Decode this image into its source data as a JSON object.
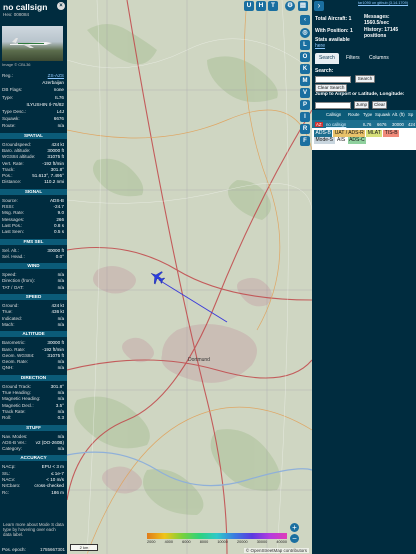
{
  "left": {
    "title": "no callsign",
    "hex_label": "Hex: 008084",
    "photo_credit": "Image © CBL36",
    "info": [
      {
        "k": "Reg.:",
        "v": "ZS-AZS",
        "link": true
      },
      {
        "k": "",
        "v": "Azerbaijan",
        "link": false
      },
      {
        "k": "DB Flags:",
        "v": "none",
        "link": false
      },
      {
        "k": "Type:",
        "v": "IL76",
        "link": false
      },
      {
        "k": "",
        "v": "ILYUSHIN Il-76/82",
        "link": false
      },
      {
        "k": "Type Desc.:",
        "v": "L4J",
        "link": false
      },
      {
        "k": "Squawk:",
        "v": "6676",
        "link": false
      },
      {
        "k": "Route:",
        "v": "n/a",
        "link": false
      }
    ],
    "sections": {
      "spatial": {
        "title": "SPATIAL",
        "rows": [
          {
            "k": "Groundspeed:",
            "v": "424 kt"
          },
          {
            "k": "Baro. altitude:",
            "v": "30000 ft"
          },
          {
            "k": "WGS84 altitude:",
            "v": "31075 ft"
          },
          {
            "k": "Vert. Rate:",
            "v": "-192 ft/min"
          },
          {
            "k": "Track:",
            "v": "301.8°"
          },
          {
            "k": "Pos.:",
            "v": "51.613°, 7.495°"
          },
          {
            "k": "Distance:",
            "v": "110.2 nmi"
          }
        ]
      },
      "signal": {
        "title": "SIGNAL",
        "rows": [
          {
            "k": "Source:",
            "v": "ADS-B"
          },
          {
            "k": "RSSI:",
            "v": "-24.7"
          },
          {
            "k": "Msg. Rate:",
            "v": "9.0"
          },
          {
            "k": "Messages:",
            "v": "266"
          },
          {
            "k": "Last Pos.:",
            "v": "0.8 s"
          },
          {
            "k": "Last Seen:",
            "v": "0.5 s"
          }
        ]
      },
      "fms": {
        "title": "FMS SEL",
        "rows": [
          {
            "k": "Sel. Alt.:",
            "v": "30000 ft"
          },
          {
            "k": "Sel. Head.:",
            "v": "0.0°"
          }
        ]
      },
      "wind": {
        "title": "WIND",
        "rows": [
          {
            "k": "Speed:",
            "v": "n/a"
          },
          {
            "k": "Direction (from):",
            "v": "n/a"
          },
          {
            "k": "TAT / OAT:",
            "v": "n/a"
          }
        ]
      },
      "speed": {
        "title": "SPEED",
        "rows": [
          {
            "k": "Ground:",
            "v": "424 kt"
          },
          {
            "k": "True:",
            "v": "436 kt"
          },
          {
            "k": "Indicated:",
            "v": "n/a"
          },
          {
            "k": "Mach:",
            "v": "n/a"
          }
        ]
      },
      "altitude": {
        "title": "ALTITUDE",
        "rows": [
          {
            "k": "Barometric:",
            "v": "30000 ft"
          },
          {
            "k": "Baro. Rate:",
            "v": "-192 ft/min"
          },
          {
            "k": "Geom. WGS84:",
            "v": "31075 ft"
          },
          {
            "k": "Geom. Rate:",
            "v": "n/a"
          },
          {
            "k": "QNH:",
            "v": "n/a"
          }
        ]
      },
      "direction": {
        "title": "DIRECTION",
        "rows": [
          {
            "k": "Ground Track:",
            "v": "301.8°"
          },
          {
            "k": "True Heading:",
            "v": "n/a"
          },
          {
            "k": "Magnetic Heading:",
            "v": "n/a"
          },
          {
            "k": "Magnetic Decl.:",
            "v": "3.5°"
          },
          {
            "k": "Track Rate:",
            "v": "n/a"
          },
          {
            "k": "Roll:",
            "v": "0.3"
          }
        ]
      },
      "stuff": {
        "title": "STUFF",
        "rows": [
          {
            "k": "Nav. Modes:",
            "v": "n/a"
          },
          {
            "k": "ADS-B Ver.:",
            "v": "v2 (DO-260B)"
          },
          {
            "k": "Category:",
            "v": "n/a"
          }
        ]
      },
      "accuracy": {
        "title": "ACCURACY",
        "rows": [
          {
            "k": "NACp:",
            "v": "EPU < 3 m"
          },
          {
            "k": "SIL:",
            "v": "≤ 1e-7"
          },
          {
            "k": "NACv:",
            "v": "< 10 m/s"
          },
          {
            "k": "NICbaro:",
            "v": "cross-checked"
          },
          {
            "k": "Rc:",
            "v": "186 m"
          }
        ]
      }
    },
    "learn_more": "Learn more about Mode S data type by hovering over each data label.",
    "pos_epoch_label": "Pos. epoch:",
    "pos_epoch_value": "1755667301"
  },
  "map": {
    "top_buttons": [
      "U",
      "H",
      "T"
    ],
    "side_buttons": [
      "L",
      "O",
      "K",
      "M",
      "V",
      "P",
      "I",
      "R",
      "F"
    ],
    "scale_label": "2 km",
    "alt_ticks": [
      "2000",
      "4000",
      "6000",
      "8000",
      "10000",
      "20000",
      "30000",
      "40000"
    ],
    "attribution": "© OpenStreetMap contributors",
    "zoom_in": "+",
    "zoom_out": "−",
    "city_label": "Dortmund",
    "aircraft_heading_deg": 301.8,
    "colors": {
      "track": "#3b3bd9",
      "aircraft": "#2b3de0"
    }
  },
  "right": {
    "version_link": "tar1090 on github (3.14.1709)",
    "total_aircraft": "Total Aircraft: 1",
    "with_position": "With Position: 1",
    "stats": "Stats available",
    "stats_link": "here",
    "messages": "Messages: 1560.5/sec",
    "history": "History: 17145 positions",
    "tabs": [
      "Search",
      "Filters",
      "Columns"
    ],
    "search_label": "Search:",
    "search_button": "Search",
    "clear_search_button": "Clear Search",
    "jump_label": "Jump to Airport or Latitude, Longitude:",
    "jump_button": "Jump",
    "clear_button": "Clear",
    "table_headers": [
      "Callsign",
      "Route",
      "Type",
      "Squawk",
      "Alt. (ft)",
      "Sp"
    ],
    "table_row": {
      "flag": "AZ",
      "callsign": "no callsign",
      "type": "IL76",
      "squawk": "6676",
      "alt": "30000",
      "spd": "424"
    },
    "sources": [
      {
        "label": "ADS-B",
        "color": "#1d6f8f"
      },
      {
        "label": "UAT / ADS-R",
        "color": "#e8c26a"
      },
      {
        "label": "MLAT",
        "color": "#d6e07a"
      },
      {
        "label": "TIS-B",
        "color": "#f08a7a"
      },
      {
        "label": "Mode-S",
        "color": "#c9d6df"
      },
      {
        "label": "AIS",
        "color": "#ffffff"
      },
      {
        "label": "ADS-C",
        "color": "#8fd19e"
      }
    ]
  }
}
